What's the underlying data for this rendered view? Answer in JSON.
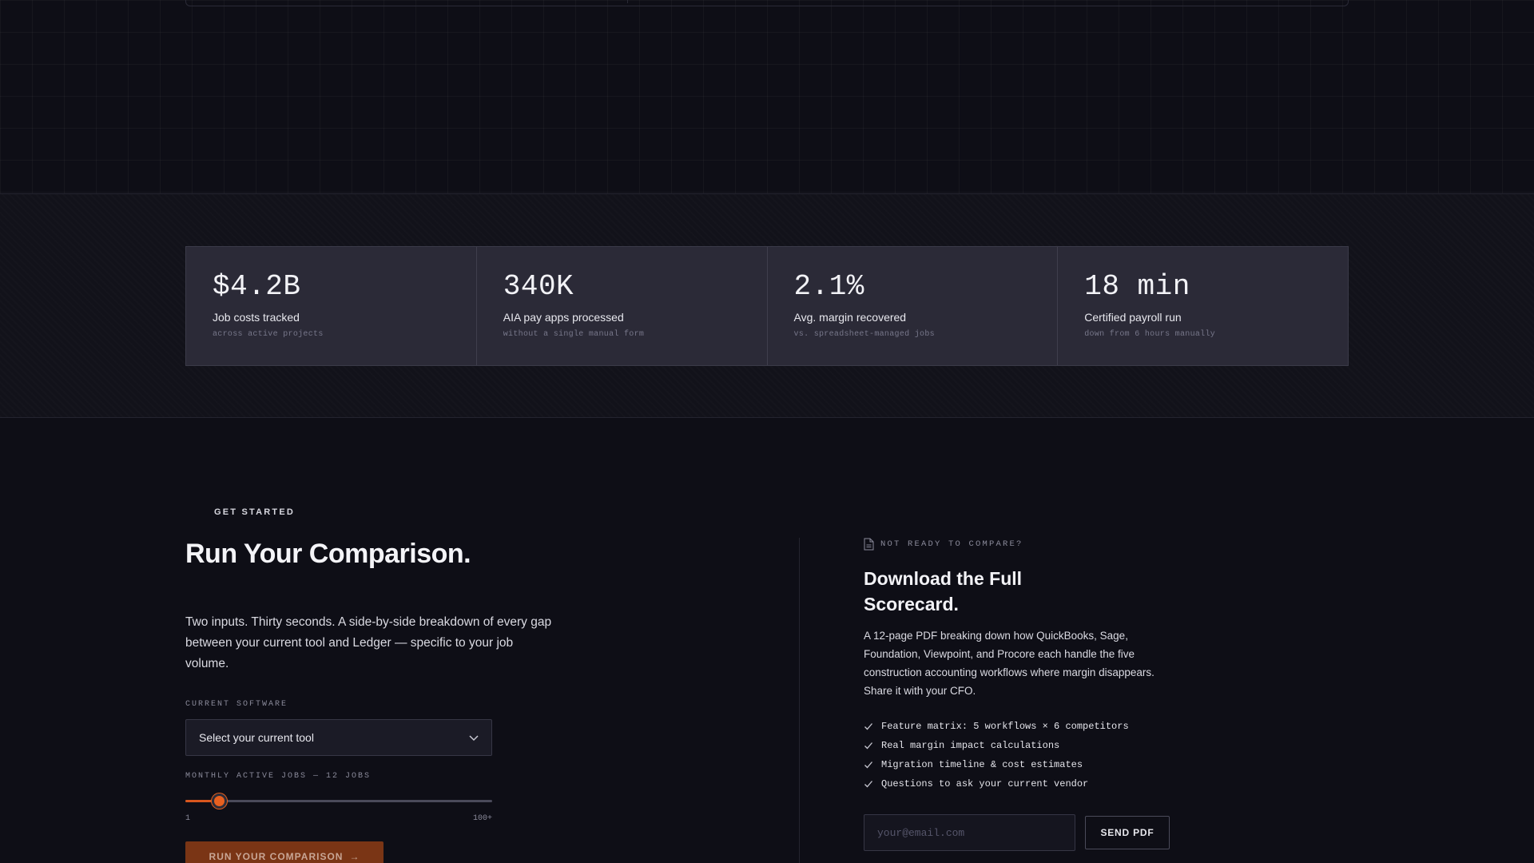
{
  "stats": [
    {
      "value": "$4.2B",
      "label": "Job costs tracked",
      "sub": "across active projects"
    },
    {
      "value": "340K",
      "label": "AIA pay apps processed",
      "sub": "without a single manual form"
    },
    {
      "value": "2.1%",
      "label": "Avg. margin recovered",
      "sub": "vs. spreadsheet-managed jobs"
    },
    {
      "value": "18 min",
      "label": "Certified payroll run",
      "sub": "down from 6 hours manually"
    }
  ],
  "get_started": {
    "eyebrow": "GET STARTED",
    "title": "Run Your Comparison.",
    "description": "Two inputs. Thirty seconds. A side-by-side breakdown of every gap between your current tool and Ledger — specific to your job volume.",
    "software_label": "CURRENT SOFTWARE",
    "software_selected": "Select your current tool",
    "jobs_label": "MONTHLY ACTIVE JOBS — 12 JOBS",
    "jobs_value": 12,
    "slider_min_label": "1",
    "slider_max_label": "100+",
    "run_button": "RUN YOUR COMPARISON",
    "run_arrow": "→"
  },
  "scorecard": {
    "eyebrow": "NOT READY TO COMPARE?",
    "title": "Download the Full Scorecard.",
    "description": "A 12-page PDF breaking down how QuickBooks, Sage, Foundation, Viewpoint, and Procore each handle the five construction accounting workflows where margin disappears. Share it with your CFO.",
    "features": [
      "Feature matrix: 5 workflows × 6 competitors",
      "Real margin impact calculations",
      "Migration timeline & cost estimates",
      "Questions to ask your current vendor"
    ],
    "email_placeholder": "your@email.com",
    "send_button": "SEND PDF"
  },
  "colors": {
    "accent": "#e8601f",
    "background": "#0e0e16",
    "stat_card": "#2b2a37"
  }
}
